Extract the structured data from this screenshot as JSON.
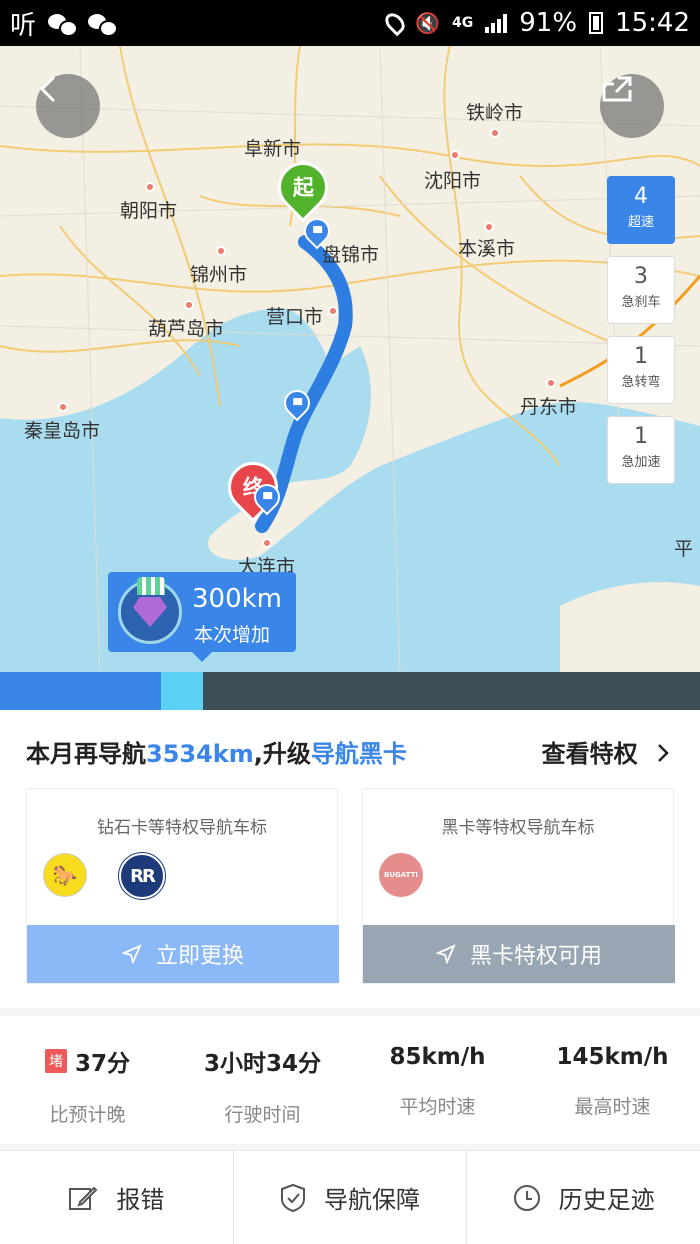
{
  "status_bar": {
    "app_text": "听",
    "network": "4G",
    "battery": "91%",
    "time": "15:42"
  },
  "map": {
    "cities": [
      {
        "name": "阜新市"
      },
      {
        "name": "铁岭市"
      },
      {
        "name": "沈阳市"
      },
      {
        "name": "朝阳市"
      },
      {
        "name": "盘锦市"
      },
      {
        "name": "本溪市"
      },
      {
        "name": "锦州市"
      },
      {
        "name": "葫芦岛市"
      },
      {
        "name": "营口市"
      },
      {
        "name": "丹东市"
      },
      {
        "name": "秦皇岛市"
      },
      {
        "name": "大连市"
      },
      {
        "name": "平"
      }
    ],
    "start_label": "起",
    "end_label": "终",
    "stats": [
      {
        "count": "4",
        "label": "超速"
      },
      {
        "count": "3",
        "label": "急刹车"
      },
      {
        "count": "1",
        "label": "急转弯"
      },
      {
        "count": "1",
        "label": "急加速"
      }
    ],
    "bubble": {
      "km": "300km",
      "sub": "本次增加"
    }
  },
  "progress": {
    "done_fraction": 0.23,
    "current_fraction": 0.06
  },
  "upgrade": {
    "prefix": "本月再导航",
    "distance": "3534km",
    "mid": ",升级",
    "card_name": "导航黑卡",
    "link": "查看特权"
  },
  "cards": [
    {
      "title": "钻石卡等特权导航车标",
      "button": "立即更换",
      "button_color": "#8bb8f7",
      "logos": [
        "ferrari",
        "rolls-royce"
      ]
    },
    {
      "title": "黑卡等特权导航车标",
      "button": "黑卡特权可用",
      "button_color": "#98a6b3",
      "logos": [
        "bugatti"
      ]
    }
  ],
  "logo_text": {
    "ferrari": "🐎",
    "rr": "RR",
    "bugatti": "BUGATTI"
  },
  "stats": [
    {
      "value": "37分",
      "label": "比预计晚",
      "badge": "堵"
    },
    {
      "value": "3小时34分",
      "label": "行驶时间"
    },
    {
      "value": "85km/h",
      "label": "平均时速"
    },
    {
      "value": "145km/h",
      "label": "最高时速"
    }
  ],
  "actions": [
    {
      "label": "报错",
      "icon": "edit-icon"
    },
    {
      "label": "导航保障",
      "icon": "shield-icon"
    },
    {
      "label": "历史足迹",
      "icon": "clock-icon"
    }
  ],
  "colors": {
    "accent": "#3a86e8",
    "start_green": "#52b22b",
    "end_red": "#e8454b",
    "sea": "#a9dcef"
  }
}
